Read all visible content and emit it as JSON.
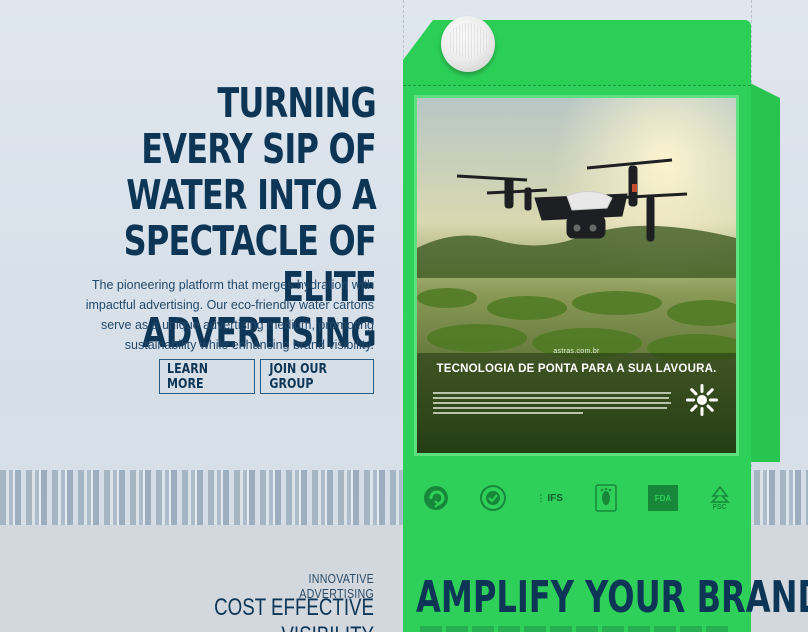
{
  "hero": {
    "title_lines": [
      "Turning every sip of",
      "water into a",
      "spectacle of elite",
      "advertising"
    ],
    "description_lines": [
      "The pioneering platform that merges hydration with",
      "impactful advertising. Our eco-friendly water cartons",
      "serve as a unique advertising medium, promoting",
      "sustainability while enhancing brand visibility."
    ],
    "buttons": {
      "learn_more": "Learn more",
      "join_group": "Join our group"
    }
  },
  "carton": {
    "ad": {
      "url": "astras.com.br",
      "headline": "TECNOLOGIA DE PONTA PARA A SUA LAVOURA."
    },
    "certifications": [
      "recycle-icon",
      "certified-icon",
      "IFS",
      "footprint-icon",
      "FDA",
      "FSC"
    ],
    "cert_labels": {
      "ifs": "IFS",
      "fda": "FDA",
      "fsc": "FSC"
    },
    "headline": "Amplify your brand"
  },
  "features": {
    "eyebrow": "Innovative advertising",
    "title": "Cost effective  visibility"
  },
  "colors": {
    "navy": "#0d3556",
    "carton_green": "#2fd05a",
    "background": "#dfe6ee"
  }
}
